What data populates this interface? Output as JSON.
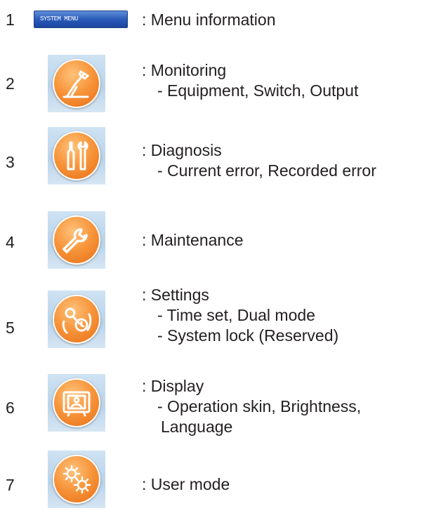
{
  "items": [
    {
      "num": "1",
      "icon": "system-menu-button",
      "button_label": "SYSTEM MENU",
      "title": ": Menu information",
      "lines": []
    },
    {
      "num": "2",
      "icon": "robot-arm-icon",
      "title": ": Monitoring",
      "lines": [
        "- Equipment, Switch, Output"
      ]
    },
    {
      "num": "3",
      "icon": "tools-icon",
      "title": ": Diagnosis",
      "lines": [
        "- Current error, Recorded error"
      ]
    },
    {
      "num": "4",
      "icon": "wrench-icon",
      "title": ": Maintenance",
      "lines": []
    },
    {
      "num": "5",
      "icon": "key-clock-icon",
      "title": ": Settings",
      "lines": [
        "- Time set, Dual mode",
        "- System lock (Reserved)"
      ]
    },
    {
      "num": "6",
      "icon": "display-icon",
      "title": ": Display",
      "lines": [
        "- Operation skin, Brightness,",
        "Language"
      ]
    },
    {
      "num": "7",
      "icon": "gears-icon",
      "title": ": User mode",
      "lines": []
    }
  ],
  "colors": {
    "orb": "#f7953b",
    "tile": "#c4dbef",
    "button": "#2a5bb9"
  }
}
